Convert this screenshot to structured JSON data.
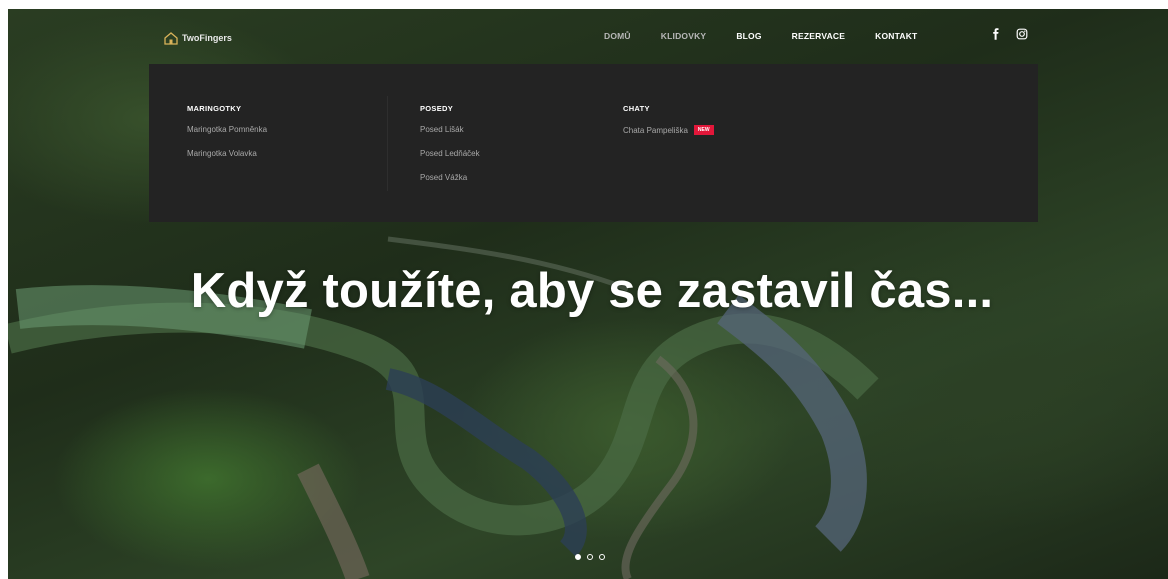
{
  "brand": {
    "name": "TwoFingers",
    "icon": "cabin-logo-icon"
  },
  "nav": {
    "items": [
      {
        "label": "DOMŮ",
        "active": false
      },
      {
        "label": "KLIDOVKY",
        "active": false
      },
      {
        "label": "BLOG",
        "active": true
      },
      {
        "label": "REZERVACE",
        "active": true
      },
      {
        "label": "KONTAKT",
        "active": true
      }
    ]
  },
  "social": {
    "facebook": "facebook-icon",
    "instagram": "instagram-icon"
  },
  "mega_menu": {
    "columns": [
      {
        "heading": "MARINGOTKY",
        "items": [
          "Maringotka Pomněnka",
          "Maringotka Volavka"
        ]
      },
      {
        "heading": "POSEDY",
        "items": [
          "Posed Lišák",
          "Posed Ledňáček",
          "Posed Vážka"
        ]
      },
      {
        "heading": "CHATY",
        "items": [
          "Chata Pampeliška"
        ],
        "badge": "NEW"
      }
    ]
  },
  "hero": {
    "headline": "Když toužíte, aby se zastavil čas..."
  },
  "slider": {
    "count": 3,
    "active_index": 0
  },
  "colors": {
    "menu_bg": "#232323",
    "badge": "#e3173a",
    "text": "#ffffff"
  }
}
